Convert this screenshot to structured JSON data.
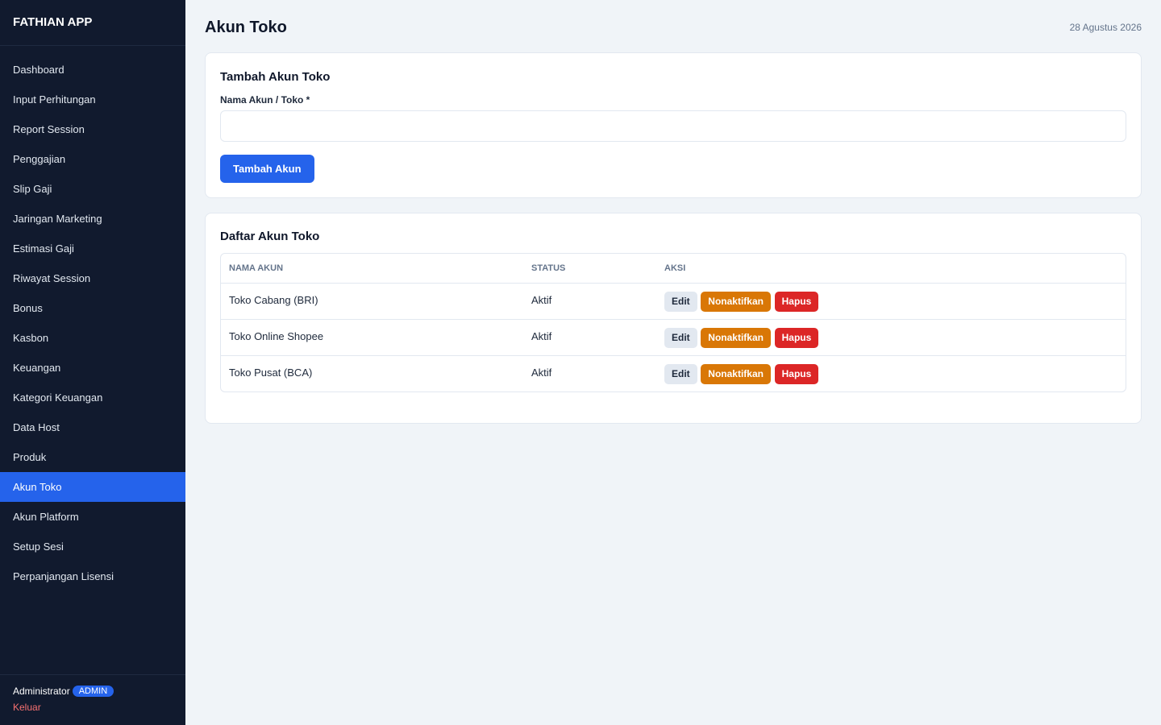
{
  "app": {
    "brand": "FATHIAN APP"
  },
  "sidebar": {
    "items": [
      {
        "label": "Dashboard",
        "active": false
      },
      {
        "label": "Input Perhitungan",
        "active": false
      },
      {
        "label": "Report Session",
        "active": false
      },
      {
        "label": "Penggajian",
        "active": false
      },
      {
        "label": "Slip Gaji",
        "active": false
      },
      {
        "label": "Jaringan Marketing",
        "active": false
      },
      {
        "label": "Estimasi Gaji",
        "active": false
      },
      {
        "label": "Riwayat Session",
        "active": false
      },
      {
        "label": "Bonus",
        "active": false
      },
      {
        "label": "Kasbon",
        "active": false
      },
      {
        "label": "Keuangan",
        "active": false
      },
      {
        "label": "Kategori Keuangan",
        "active": false
      },
      {
        "label": "Data Host",
        "active": false
      },
      {
        "label": "Produk",
        "active": false
      },
      {
        "label": "Akun Toko",
        "active": true
      },
      {
        "label": "Akun Platform",
        "active": false
      },
      {
        "label": "Setup Sesi",
        "active": false
      },
      {
        "label": "Perpanjangan Lisensi",
        "active": false
      }
    ],
    "footer": {
      "user_name": "Administrator",
      "role_badge": "ADMIN",
      "logout_label": "Keluar"
    }
  },
  "header": {
    "title": "Akun Toko",
    "date": "28 Agustus 2026"
  },
  "add_form": {
    "title": "Tambah Akun Toko",
    "field_label": "Nama Akun / Toko *",
    "field_value": "",
    "field_placeholder": "",
    "submit_label": "Tambah Akun"
  },
  "list": {
    "title": "Daftar Akun Toko",
    "columns": [
      "NAMA AKUN",
      "STATUS",
      "AKSI"
    ],
    "rows": [
      {
        "name": "Toko Cabang (BRI)",
        "status": "Aktif"
      },
      {
        "name": "Toko Online Shopee",
        "status": "Aktif"
      },
      {
        "name": "Toko Pusat (BCA)",
        "status": "Aktif"
      }
    ],
    "actions": {
      "edit": "Edit",
      "deactivate": "Nonaktifkan",
      "delete": "Hapus"
    }
  },
  "colors": {
    "sidebar_bg": "#111a2e",
    "accent": "#2563eb",
    "warning": "#d97706",
    "danger": "#dc2626",
    "page_bg": "#f0f4f8"
  }
}
